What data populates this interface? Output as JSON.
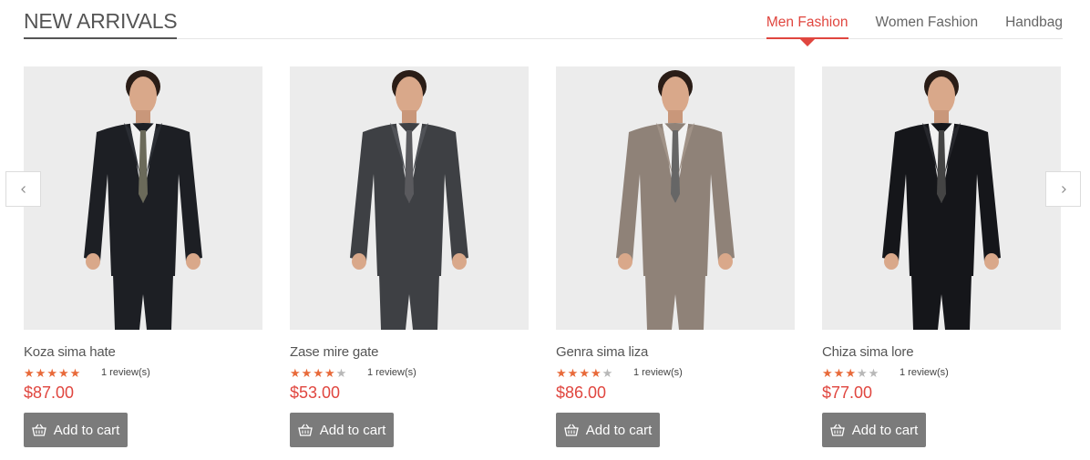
{
  "section": {
    "title": "NEW ARRIVALS",
    "tabs": [
      {
        "label": "Men Fashion",
        "active": true
      },
      {
        "label": "Women Fashion",
        "active": false
      },
      {
        "label": "Handbag",
        "active": false
      }
    ]
  },
  "carousel": {
    "prev_icon": "chevron-left-icon",
    "next_icon": "chevron-right-icon"
  },
  "products": [
    {
      "name": "Koza sima hate",
      "rating": 5,
      "reviews": "1 review(s)",
      "price": "$87.00",
      "button": "Add to cart",
      "suit_color": "#1d1f24",
      "lapel_color": "#2a2d33",
      "tie_color": "#6b6a5a"
    },
    {
      "name": "Zase mire gate",
      "rating": 4,
      "reviews": "1 review(s)",
      "price": "$53.00",
      "button": "Add to cart",
      "suit_color": "#3e4044",
      "lapel_color": "#505257",
      "tie_color": "#5a5a5e"
    },
    {
      "name": "Genra sima liza",
      "rating": 4,
      "reviews": "1 review(s)",
      "price": "$86.00",
      "button": "Add to cart",
      "suit_color": "#8f8278",
      "lapel_color": "#a09287",
      "tie_color": "#666"
    },
    {
      "name": "Chiza sima lore",
      "rating": 3,
      "reviews": "1 review(s)",
      "price": "$77.00",
      "button": "Add to cart",
      "suit_color": "#15161a",
      "lapel_color": "#26272c",
      "tie_color": "#444"
    }
  ],
  "colors": {
    "accent": "#e0463f",
    "star_on": "#e86a3a",
    "star_off": "#b8b8b8",
    "button_bg": "#7b7b7b",
    "image_bg": "#ececec"
  }
}
